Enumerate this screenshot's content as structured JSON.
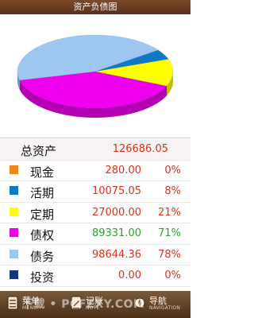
{
  "header": {
    "title": "资产负债图"
  },
  "chart_data": {
    "type": "pie",
    "slices": [
      {
        "name": "活期",
        "value": 10075.05,
        "percent": 8,
        "color": "#0e79c6"
      },
      {
        "name": "定期",
        "value": 27000.0,
        "percent": 21,
        "color": "#ffff00"
      },
      {
        "name": "债权",
        "value": 89331.0,
        "percent": 71,
        "color": "#ee00ee"
      },
      {
        "name": "债务",
        "value": 98644.36,
        "percent": 78,
        "color": "#9cc7f0"
      }
    ]
  },
  "table": {
    "total": {
      "label": "总资产",
      "value": "126686.05"
    },
    "rows": [
      {
        "name": "现金",
        "value": "280.00",
        "percent": "0%",
        "color": "#f0871a"
      },
      {
        "name": "活期",
        "value": "10075.05",
        "percent": "8%",
        "color": "#0e79c6"
      },
      {
        "name": "定期",
        "value": "27000.00",
        "percent": "21%",
        "color": "#ffff00"
      },
      {
        "name": "债权",
        "value": "89331.00",
        "percent": "71%",
        "color": "#ee00ee"
      },
      {
        "name": "债务",
        "value": "98644.36",
        "percent": "78%",
        "color": "#9cc7f0"
      },
      {
        "name": "投资",
        "value": "0.00",
        "percent": "0%",
        "color": "#123a7a"
      }
    ]
  },
  "toolbar": {
    "items": [
      {
        "label": "菜单",
        "sub": "MENU",
        "icon": "menu-icon"
      },
      {
        "label": "记账",
        "sub": "NOTE",
        "icon": "note-icon"
      },
      {
        "label": "导航",
        "sub": "NAVIGATION",
        "icon": "navigation-icon"
      }
    ],
    "watermark": "下载 • PCFZXY.COM"
  }
}
